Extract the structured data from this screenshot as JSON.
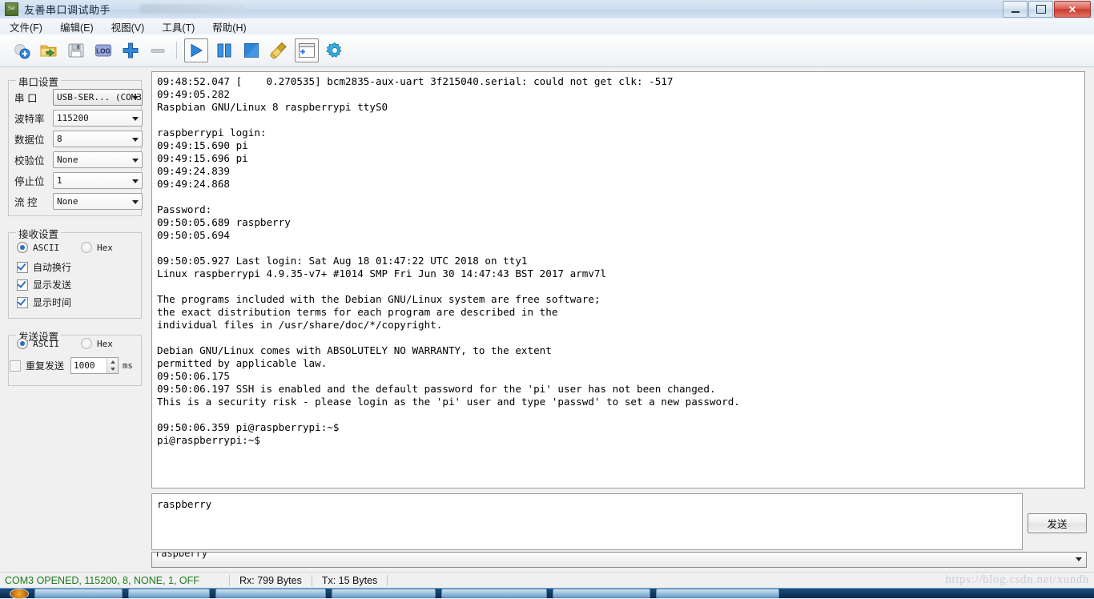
{
  "window": {
    "title": "友善串口调试助手",
    "app_icon": "serial-app-icon",
    "minimize_label": "",
    "maximize_label": "",
    "close_label": "✕"
  },
  "menubar": {
    "items": [
      {
        "label": "文件(F)",
        "name": "menu-file"
      },
      {
        "label": "编辑(E)",
        "name": "menu-edit"
      },
      {
        "label": "视图(V)",
        "name": "menu-view"
      },
      {
        "label": "工具(T)",
        "name": "menu-tools"
      },
      {
        "label": "帮助(H)",
        "name": "menu-help"
      }
    ]
  },
  "toolbar": {
    "buttons": [
      {
        "icon": "new-connection-icon",
        "disabled": true
      },
      {
        "icon": "open-folder-icon",
        "disabled": false
      },
      {
        "icon": "save-disk-icon",
        "disabled": false
      },
      {
        "icon": "log-icon",
        "label": "LOG",
        "disabled": false
      },
      {
        "icon": "add-plus-icon",
        "disabled": false
      },
      {
        "icon": "remove-minus-icon",
        "disabled": true
      },
      {
        "icon": "play-icon",
        "disabled": false
      },
      {
        "icon": "pause-icon",
        "disabled": false
      },
      {
        "icon": "stop-icon",
        "disabled": false
      },
      {
        "icon": "clear-broom-icon",
        "disabled": false
      },
      {
        "icon": "new-window-icon",
        "active": true
      },
      {
        "icon": "gear-settings-icon",
        "disabled": false
      }
    ]
  },
  "serial_settings": {
    "title": "串口设置",
    "fields": [
      {
        "label": "串  口",
        "value": "USB-SER... (COM3",
        "name": "port-select"
      },
      {
        "label": "波特率",
        "value": "115200",
        "name": "baudrate-select"
      },
      {
        "label": "数据位",
        "value": "8",
        "name": "databits-select"
      },
      {
        "label": "校验位",
        "value": "None",
        "name": "parity-select"
      },
      {
        "label": "停止位",
        "value": "1",
        "name": "stopbits-select"
      },
      {
        "label": "流  控",
        "value": "None",
        "name": "flowcontrol-select"
      }
    ]
  },
  "receive_settings": {
    "title": "接收设置",
    "format_ascii": "ASCII",
    "format_hex": "Hex",
    "format_selected": "ASCII",
    "checkboxes": [
      {
        "label": "自动换行",
        "checked": true,
        "name": "auto-wrap-checkbox"
      },
      {
        "label": "显示发送",
        "checked": true,
        "name": "show-send-checkbox"
      },
      {
        "label": "显示时间",
        "checked": true,
        "name": "show-time-checkbox"
      }
    ]
  },
  "send_settings": {
    "title": "发送设置",
    "format_ascii": "ASCII",
    "format_hex": "Hex",
    "format_selected": "ASCII",
    "repeat_label": "重复发送",
    "repeat_checked": false,
    "repeat_interval": "1000",
    "repeat_unit": "ms"
  },
  "terminal": {
    "content": "09:48:52.047 [    0.270535] bcm2835-aux-uart 3f215040.serial: could not get clk: -517\n09:49:05.282\nRaspbian GNU/Linux 8 raspberrypi ttyS0\n\nraspberrypi login:\n09:49:15.690 pi\n09:49:15.696 pi\n09:49:24.839\n09:49:24.868\n\nPassword:\n09:50:05.689 raspberry\n09:50:05.694\n\n09:50:05.927 Last login: Sat Aug 18 01:47:22 UTC 2018 on tty1\nLinux raspberrypi 4.9.35-v7+ #1014 SMP Fri Jun 30 14:47:43 BST 2017 armv7l\n\nThe programs included with the Debian GNU/Linux system are free software;\nthe exact distribution terms for each program are described in the\nindividual files in /usr/share/doc/*/copyright.\n\nDebian GNU/Linux comes with ABSOLUTELY NO WARRANTY, to the extent\npermitted by applicable law.\n09:50:06.175\n09:50:06.197 SSH is enabled and the default password for the 'pi' user has not been changed.\nThis is a security risk - please login as the 'pi' user and type 'passwd' to set a new password.\n\n09:50:06.359 pi@raspberrypi:~$\npi@raspberrypi:~$"
  },
  "send_area": {
    "input_value": "raspberry",
    "send_button_label": "发送",
    "history_value": "raspberry"
  },
  "statusbar": {
    "connection": "COM3 OPENED, 115200, 8, NONE, 1, OFF",
    "rx": "Rx: 799 Bytes",
    "tx": "Tx: 15 Bytes",
    "connection_color": "#1e7a1e"
  },
  "watermark": {
    "text": "https://blog.csdn.net/xundh"
  }
}
